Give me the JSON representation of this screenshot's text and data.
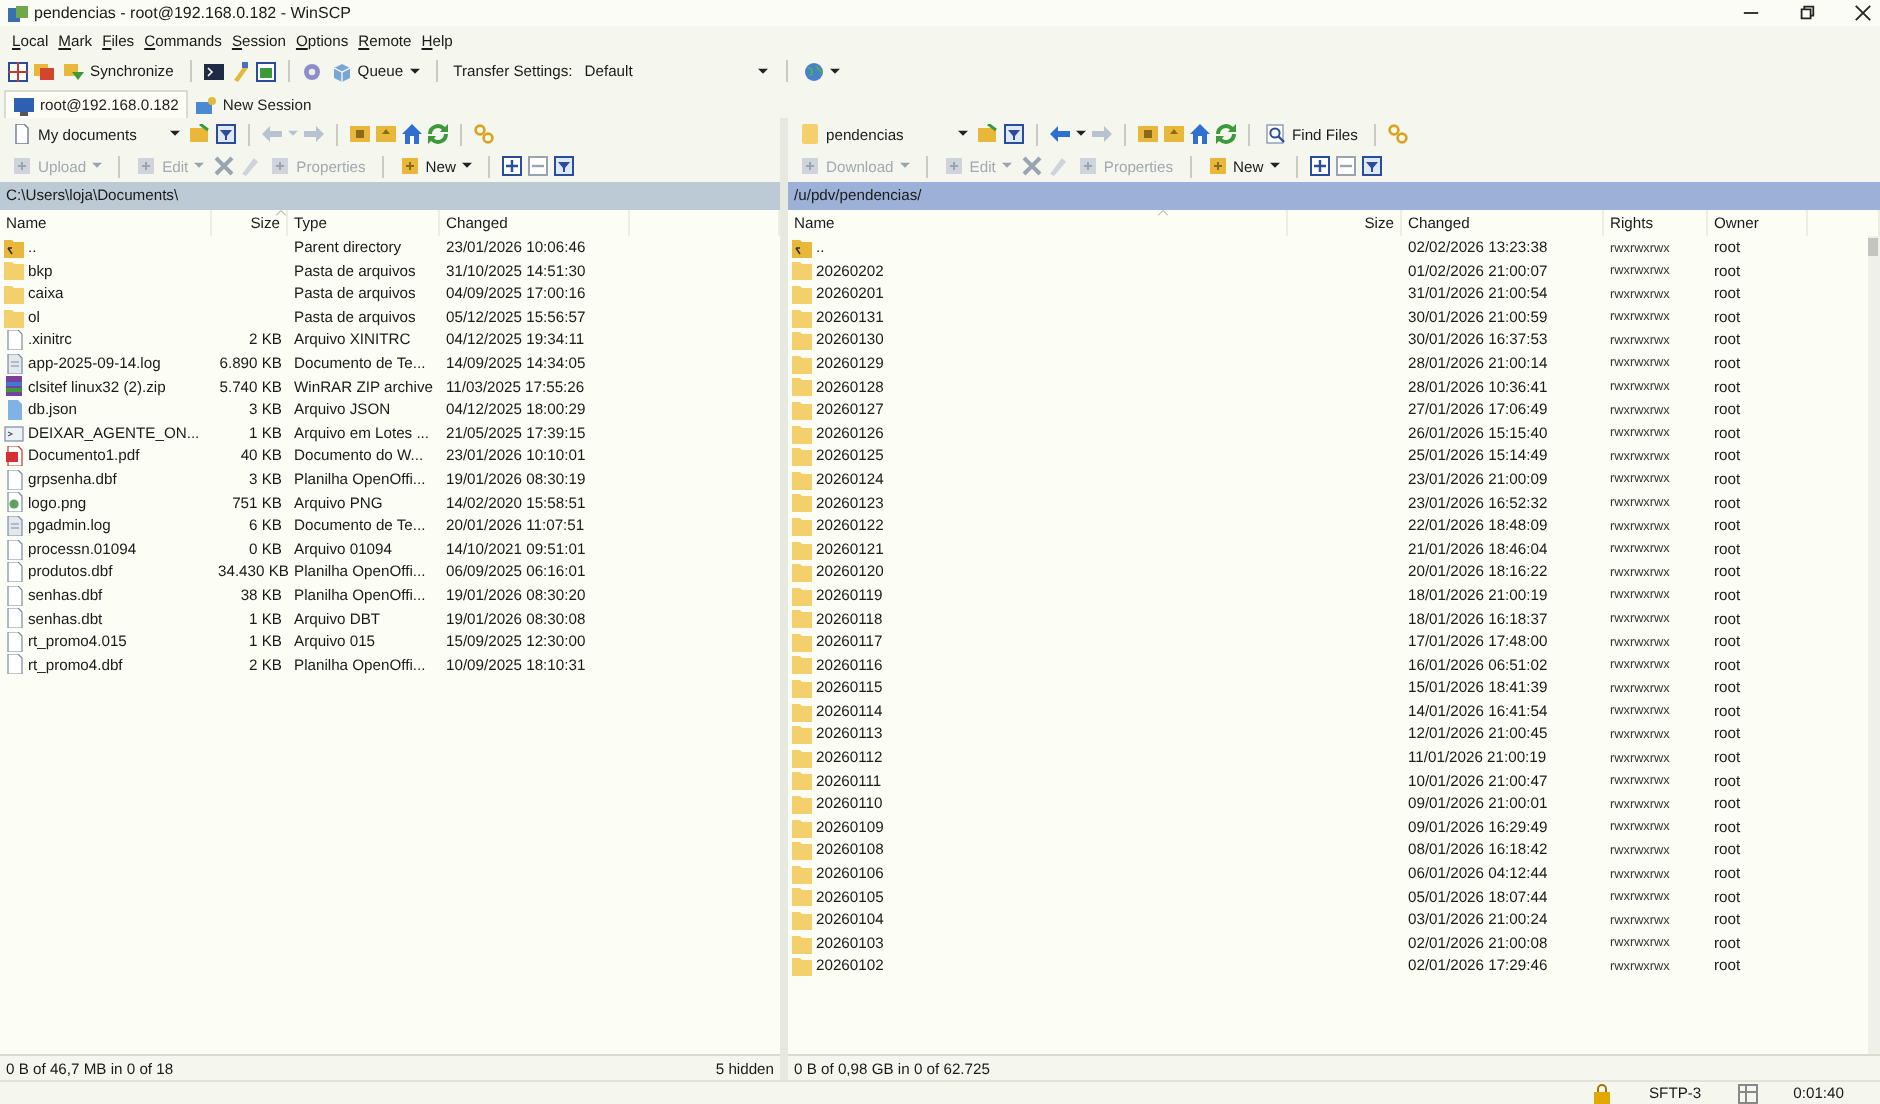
{
  "window": {
    "title": "pendencias - root@192.168.0.182 - WinSCP"
  },
  "menu": [
    "Local",
    "Mark",
    "Files",
    "Commands",
    "Session",
    "Options",
    "Remote",
    "Help"
  ],
  "toolbar": {
    "synchronize": "Synchronize",
    "queue": "Queue",
    "transfer_label": "Transfer Settings:",
    "transfer_value": "Default"
  },
  "tabs": [
    {
      "label": "root@192.168.0.182",
      "selected": true
    },
    {
      "label": "New Session",
      "selected": false
    }
  ],
  "left_panel": {
    "active": false,
    "location": "My documents",
    "buttons": [
      {
        "label": "Upload",
        "disabled": true
      },
      {
        "label": "Edit",
        "disabled": true
      },
      {
        "label": "Properties",
        "disabled": true
      },
      {
        "label": "New",
        "disabled": false
      }
    ],
    "path": "C:\\Users\\loja\\Documents\\",
    "columns": [
      "Name",
      "Size",
      "Type",
      "Changed"
    ],
    "rows": [
      {
        "kind": "parent",
        "name": "..",
        "type": "Parent directory",
        "changed": "23/01/2026 10:06:46"
      },
      {
        "kind": "folder",
        "name": "bkp",
        "type": "Pasta de arquivos",
        "changed": "31/10/2025 14:51:30"
      },
      {
        "kind": "folder",
        "name": "caixa",
        "type": "Pasta de arquivos",
        "changed": "04/09/2025 17:00:16"
      },
      {
        "kind": "folder",
        "name": "ol",
        "type": "Pasta de arquivos",
        "changed": "05/12/2025 15:56:57"
      },
      {
        "kind": "file",
        "name": ".xinitrc",
        "size": "2 KB",
        "type": "Arquivo XINITRC",
        "changed": "04/12/2025 19:34:11"
      },
      {
        "kind": "text",
        "name": "app-2025-09-14.log",
        "size": "6.890 KB",
        "type": "Documento de Te...",
        "changed": "14/09/2025 14:34:05"
      },
      {
        "kind": "zip",
        "name": "clsitef linux32 (2).zip",
        "size": "5.740 KB",
        "type": "WinRAR ZIP archive",
        "changed": "11/03/2025 17:55:26"
      },
      {
        "kind": "json",
        "name": "db.json",
        "size": "3 KB",
        "type": "Arquivo JSON",
        "changed": "04/12/2025 18:00:29"
      },
      {
        "kind": "batch",
        "name": "DEIXAR_AGENTE_ON...",
        "size": "1 KB",
        "type": "Arquivo em Lotes ...",
        "changed": "21/05/2025 17:39:15"
      },
      {
        "kind": "pdf",
        "name": "Documento1.pdf",
        "size": "40 KB",
        "type": "Documento do W...",
        "changed": "23/01/2026 10:10:01"
      },
      {
        "kind": "file",
        "name": "grpsenha.dbf",
        "size": "3 KB",
        "type": "Planilha OpenOffi...",
        "changed": "19/01/2026 08:30:19"
      },
      {
        "kind": "image",
        "name": "logo.png",
        "size": "751 KB",
        "type": "Arquivo PNG",
        "changed": "14/02/2020 15:58:51"
      },
      {
        "kind": "text",
        "name": "pgadmin.log",
        "size": "6 KB",
        "type": "Documento de Te...",
        "changed": "20/01/2026 11:07:51"
      },
      {
        "kind": "file",
        "name": "processn.01094",
        "size": "0 KB",
        "type": "Arquivo 01094",
        "changed": "14/10/2021 09:51:01"
      },
      {
        "kind": "file",
        "name": "produtos.dbf",
        "size": "34.430 KB",
        "type": "Planilha OpenOffi...",
        "changed": "06/09/2025 06:16:01"
      },
      {
        "kind": "file",
        "name": "senhas.dbf",
        "size": "38 KB",
        "type": "Planilha OpenOffi...",
        "changed": "19/01/2026 08:30:20"
      },
      {
        "kind": "file",
        "name": "senhas.dbt",
        "size": "1 KB",
        "type": "Arquivo DBT",
        "changed": "19/01/2026 08:30:08"
      },
      {
        "kind": "file",
        "name": "rt_promo4.015",
        "size": "1 KB",
        "type": "Arquivo 015",
        "changed": "15/09/2025 12:30:00"
      },
      {
        "kind": "file",
        "name": "rt_promo4.dbf",
        "size": "2 KB",
        "type": "Planilha OpenOffi...",
        "changed": "10/09/2025 18:10:31"
      }
    ],
    "status": "0 B of 46,7 MB in 0 of 18",
    "hidden": "5 hidden"
  },
  "right_panel": {
    "active": true,
    "location": "pendencias",
    "find_files": "Find Files",
    "buttons": [
      {
        "label": "Download",
        "disabled": true
      },
      {
        "label": "Edit",
        "disabled": true
      },
      {
        "label": "Properties",
        "disabled": true
      },
      {
        "label": "New",
        "disabled": false
      }
    ],
    "path": "/u/pdv/pendencias/",
    "columns": [
      "Name",
      "Size",
      "Changed",
      "Rights",
      "Owner"
    ],
    "rows": [
      {
        "kind": "parent",
        "name": "..",
        "changed": "02/02/2026 13:23:38",
        "rights": "rwxrwxrwx",
        "owner": "root"
      },
      {
        "kind": "folder",
        "name": "20260202",
        "changed": "01/02/2026 21:00:07",
        "rights": "rwxrwxrwx",
        "owner": "root"
      },
      {
        "kind": "folder",
        "name": "20260201",
        "changed": "31/01/2026 21:00:54",
        "rights": "rwxrwxrwx",
        "owner": "root"
      },
      {
        "kind": "folder",
        "name": "20260131",
        "changed": "30/01/2026 21:00:59",
        "rights": "rwxrwxrwx",
        "owner": "root"
      },
      {
        "kind": "folder",
        "name": "20260130",
        "changed": "30/01/2026 16:37:53",
        "rights": "rwxrwxrwx",
        "owner": "root"
      },
      {
        "kind": "folder",
        "name": "20260129",
        "changed": "28/01/2026 21:00:14",
        "rights": "rwxrwxrwx",
        "owner": "root"
      },
      {
        "kind": "folder",
        "name": "20260128",
        "changed": "28/01/2026 10:36:41",
        "rights": "rwxrwxrwx",
        "owner": "root"
      },
      {
        "kind": "folder",
        "name": "20260127",
        "changed": "27/01/2026 17:06:49",
        "rights": "rwxrwxrwx",
        "owner": "root"
      },
      {
        "kind": "folder",
        "name": "20260126",
        "changed": "26/01/2026 15:15:40",
        "rights": "rwxrwxrwx",
        "owner": "root"
      },
      {
        "kind": "folder",
        "name": "20260125",
        "changed": "25/01/2026 15:14:49",
        "rights": "rwxrwxrwx",
        "owner": "root"
      },
      {
        "kind": "folder",
        "name": "20260124",
        "changed": "23/01/2026 21:00:09",
        "rights": "rwxrwxrwx",
        "owner": "root"
      },
      {
        "kind": "folder",
        "name": "20260123",
        "changed": "23/01/2026 16:52:32",
        "rights": "rwxrwxrwx",
        "owner": "root"
      },
      {
        "kind": "folder",
        "name": "20260122",
        "changed": "22/01/2026 18:48:09",
        "rights": "rwxrwxrwx",
        "owner": "root"
      },
      {
        "kind": "folder",
        "name": "20260121",
        "changed": "21/01/2026 18:46:04",
        "rights": "rwxrwxrwx",
        "owner": "root"
      },
      {
        "kind": "folder",
        "name": "20260120",
        "changed": "20/01/2026 18:16:22",
        "rights": "rwxrwxrwx",
        "owner": "root"
      },
      {
        "kind": "folder",
        "name": "20260119",
        "changed": "18/01/2026 21:00:19",
        "rights": "rwxrwxrwx",
        "owner": "root"
      },
      {
        "kind": "folder",
        "name": "20260118",
        "changed": "18/01/2026 16:18:37",
        "rights": "rwxrwxrwx",
        "owner": "root"
      },
      {
        "kind": "folder",
        "name": "20260117",
        "changed": "17/01/2026 17:48:00",
        "rights": "rwxrwxrwx",
        "owner": "root"
      },
      {
        "kind": "folder",
        "name": "20260116",
        "changed": "16/01/2026 06:51:02",
        "rights": "rwxrwxrwx",
        "owner": "root"
      },
      {
        "kind": "folder",
        "name": "20260115",
        "changed": "15/01/2026 18:41:39",
        "rights": "rwxrwxrwx",
        "owner": "root"
      },
      {
        "kind": "folder",
        "name": "20260114",
        "changed": "14/01/2026 16:41:54",
        "rights": "rwxrwxrwx",
        "owner": "root"
      },
      {
        "kind": "folder",
        "name": "20260113",
        "changed": "12/01/2026 21:00:45",
        "rights": "rwxrwxrwx",
        "owner": "root"
      },
      {
        "kind": "folder",
        "name": "20260112",
        "changed": "11/01/2026 21:00:19",
        "rights": "rwxrwxrwx",
        "owner": "root"
      },
      {
        "kind": "folder",
        "name": "20260111",
        "changed": "10/01/2026 21:00:47",
        "rights": "rwxrwxrwx",
        "owner": "root"
      },
      {
        "kind": "folder",
        "name": "20260110",
        "changed": "09/01/2026 21:00:01",
        "rights": "rwxrwxrwx",
        "owner": "root"
      },
      {
        "kind": "folder",
        "name": "20260109",
        "changed": "09/01/2026 16:29:49",
        "rights": "rwxrwxrwx",
        "owner": "root"
      },
      {
        "kind": "folder",
        "name": "20260108",
        "changed": "08/01/2026 16:18:42",
        "rights": "rwxrwxrwx",
        "owner": "root"
      },
      {
        "kind": "folder",
        "name": "20260106",
        "changed": "06/01/2026 04:12:44",
        "rights": "rwxrwxrwx",
        "owner": "root"
      },
      {
        "kind": "folder",
        "name": "20260105",
        "changed": "05/01/2026 18:07:44",
        "rights": "rwxrwxrwx",
        "owner": "root"
      },
      {
        "kind": "folder",
        "name": "20260104",
        "changed": "03/01/2026 21:00:24",
        "rights": "rwxrwxrwx",
        "owner": "root"
      },
      {
        "kind": "folder",
        "name": "20260103",
        "changed": "02/01/2026 21:00:08",
        "rights": "rwxrwxrwx",
        "owner": "root"
      },
      {
        "kind": "folder",
        "name": "20260102",
        "changed": "02/01/2026 17:29:46",
        "rights": "rwxrwxrwx",
        "owner": "root"
      }
    ],
    "status": "0 B of 0,98 GB in 0 of 62.725"
  },
  "status_bar": {
    "protocol": "SFTP-3",
    "time": "0:01:40"
  }
}
